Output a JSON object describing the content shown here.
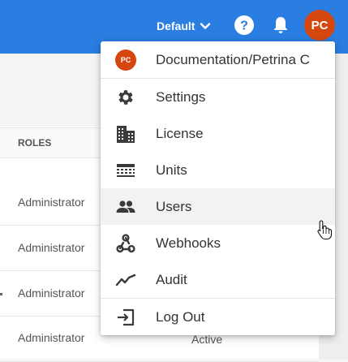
{
  "header": {
    "context_label": "Default",
    "avatar_initials": "PC"
  },
  "table": {
    "column_roles": "ROLES",
    "rows": [
      {
        "role": "Administrator",
        "status": ""
      },
      {
        "role": "Administrator",
        "status": ""
      },
      {
        "role": "Administrator",
        "status": ""
      },
      {
        "role": "Administrator",
        "status": "Active"
      }
    ]
  },
  "menu": {
    "account_avatar": "PC",
    "account_label": "Documentation/Petrina C",
    "items": [
      {
        "label": "Settings",
        "icon": "gear-icon"
      },
      {
        "label": "License",
        "icon": "building-icon"
      },
      {
        "label": "Units",
        "icon": "units-icon"
      },
      {
        "label": "Users",
        "icon": "users-icon"
      },
      {
        "label": "Webhooks",
        "icon": "webhooks-icon"
      },
      {
        "label": "Audit",
        "icon": "audit-icon"
      }
    ],
    "logout_label": "Log Out"
  },
  "colors": {
    "topbar": "#2a7de1",
    "avatar": "#d4470f",
    "menu_icon": "#3a3a3a"
  }
}
